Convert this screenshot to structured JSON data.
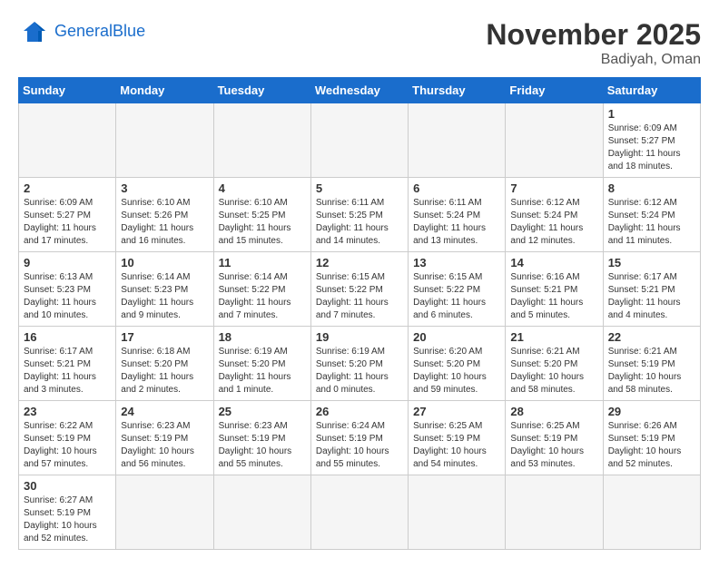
{
  "header": {
    "logo_general": "General",
    "logo_blue": "Blue",
    "month_year": "November 2025",
    "location": "Badiyah, Oman"
  },
  "weekdays": [
    "Sunday",
    "Monday",
    "Tuesday",
    "Wednesday",
    "Thursday",
    "Friday",
    "Saturday"
  ],
  "weeks": [
    [
      {
        "day": "",
        "empty": true
      },
      {
        "day": "",
        "empty": true
      },
      {
        "day": "",
        "empty": true
      },
      {
        "day": "",
        "empty": true
      },
      {
        "day": "",
        "empty": true
      },
      {
        "day": "",
        "empty": true
      },
      {
        "day": "1",
        "sunrise": "6:09 AM",
        "sunset": "5:27 PM",
        "daylight": "11 hours and 18 minutes."
      }
    ],
    [
      {
        "day": "2",
        "sunrise": "6:09 AM",
        "sunset": "5:27 PM",
        "daylight": "11 hours and 17 minutes."
      },
      {
        "day": "3",
        "sunrise": "6:10 AM",
        "sunset": "5:26 PM",
        "daylight": "11 hours and 16 minutes."
      },
      {
        "day": "4",
        "sunrise": "6:10 AM",
        "sunset": "5:25 PM",
        "daylight": "11 hours and 15 minutes."
      },
      {
        "day": "5",
        "sunrise": "6:11 AM",
        "sunset": "5:25 PM",
        "daylight": "11 hours and 14 minutes."
      },
      {
        "day": "6",
        "sunrise": "6:11 AM",
        "sunset": "5:24 PM",
        "daylight": "11 hours and 13 minutes."
      },
      {
        "day": "7",
        "sunrise": "6:12 AM",
        "sunset": "5:24 PM",
        "daylight": "11 hours and 12 minutes."
      },
      {
        "day": "8",
        "sunrise": "6:12 AM",
        "sunset": "5:24 PM",
        "daylight": "11 hours and 11 minutes."
      }
    ],
    [
      {
        "day": "9",
        "sunrise": "6:13 AM",
        "sunset": "5:23 PM",
        "daylight": "11 hours and 10 minutes."
      },
      {
        "day": "10",
        "sunrise": "6:14 AM",
        "sunset": "5:23 PM",
        "daylight": "11 hours and 9 minutes."
      },
      {
        "day": "11",
        "sunrise": "6:14 AM",
        "sunset": "5:22 PM",
        "daylight": "11 hours and 7 minutes."
      },
      {
        "day": "12",
        "sunrise": "6:15 AM",
        "sunset": "5:22 PM",
        "daylight": "11 hours and 7 minutes."
      },
      {
        "day": "13",
        "sunrise": "6:15 AM",
        "sunset": "5:22 PM",
        "daylight": "11 hours and 6 minutes."
      },
      {
        "day": "14",
        "sunrise": "6:16 AM",
        "sunset": "5:21 PM",
        "daylight": "11 hours and 5 minutes."
      },
      {
        "day": "15",
        "sunrise": "6:17 AM",
        "sunset": "5:21 PM",
        "daylight": "11 hours and 4 minutes."
      }
    ],
    [
      {
        "day": "16",
        "sunrise": "6:17 AM",
        "sunset": "5:21 PM",
        "daylight": "11 hours and 3 minutes."
      },
      {
        "day": "17",
        "sunrise": "6:18 AM",
        "sunset": "5:20 PM",
        "daylight": "11 hours and 2 minutes."
      },
      {
        "day": "18",
        "sunrise": "6:19 AM",
        "sunset": "5:20 PM",
        "daylight": "11 hours and 1 minute."
      },
      {
        "day": "19",
        "sunrise": "6:19 AM",
        "sunset": "5:20 PM",
        "daylight": "11 hours and 0 minutes."
      },
      {
        "day": "20",
        "sunrise": "6:20 AM",
        "sunset": "5:20 PM",
        "daylight": "10 hours and 59 minutes."
      },
      {
        "day": "21",
        "sunrise": "6:21 AM",
        "sunset": "5:20 PM",
        "daylight": "10 hours and 58 minutes."
      },
      {
        "day": "22",
        "sunrise": "6:21 AM",
        "sunset": "5:19 PM",
        "daylight": "10 hours and 58 minutes."
      }
    ],
    [
      {
        "day": "23",
        "sunrise": "6:22 AM",
        "sunset": "5:19 PM",
        "daylight": "10 hours and 57 minutes."
      },
      {
        "day": "24",
        "sunrise": "6:23 AM",
        "sunset": "5:19 PM",
        "daylight": "10 hours and 56 minutes."
      },
      {
        "day": "25",
        "sunrise": "6:23 AM",
        "sunset": "5:19 PM",
        "daylight": "10 hours and 55 minutes."
      },
      {
        "day": "26",
        "sunrise": "6:24 AM",
        "sunset": "5:19 PM",
        "daylight": "10 hours and 55 minutes."
      },
      {
        "day": "27",
        "sunrise": "6:25 AM",
        "sunset": "5:19 PM",
        "daylight": "10 hours and 54 minutes."
      },
      {
        "day": "28",
        "sunrise": "6:25 AM",
        "sunset": "5:19 PM",
        "daylight": "10 hours and 53 minutes."
      },
      {
        "day": "29",
        "sunrise": "6:26 AM",
        "sunset": "5:19 PM",
        "daylight": "10 hours and 52 minutes."
      }
    ],
    [
      {
        "day": "30",
        "sunrise": "6:27 AM",
        "sunset": "5:19 PM",
        "daylight": "10 hours and 52 minutes."
      },
      {
        "day": "",
        "empty": true
      },
      {
        "day": "",
        "empty": true
      },
      {
        "day": "",
        "empty": true
      },
      {
        "day": "",
        "empty": true
      },
      {
        "day": "",
        "empty": true
      },
      {
        "day": "",
        "empty": true
      }
    ]
  ]
}
